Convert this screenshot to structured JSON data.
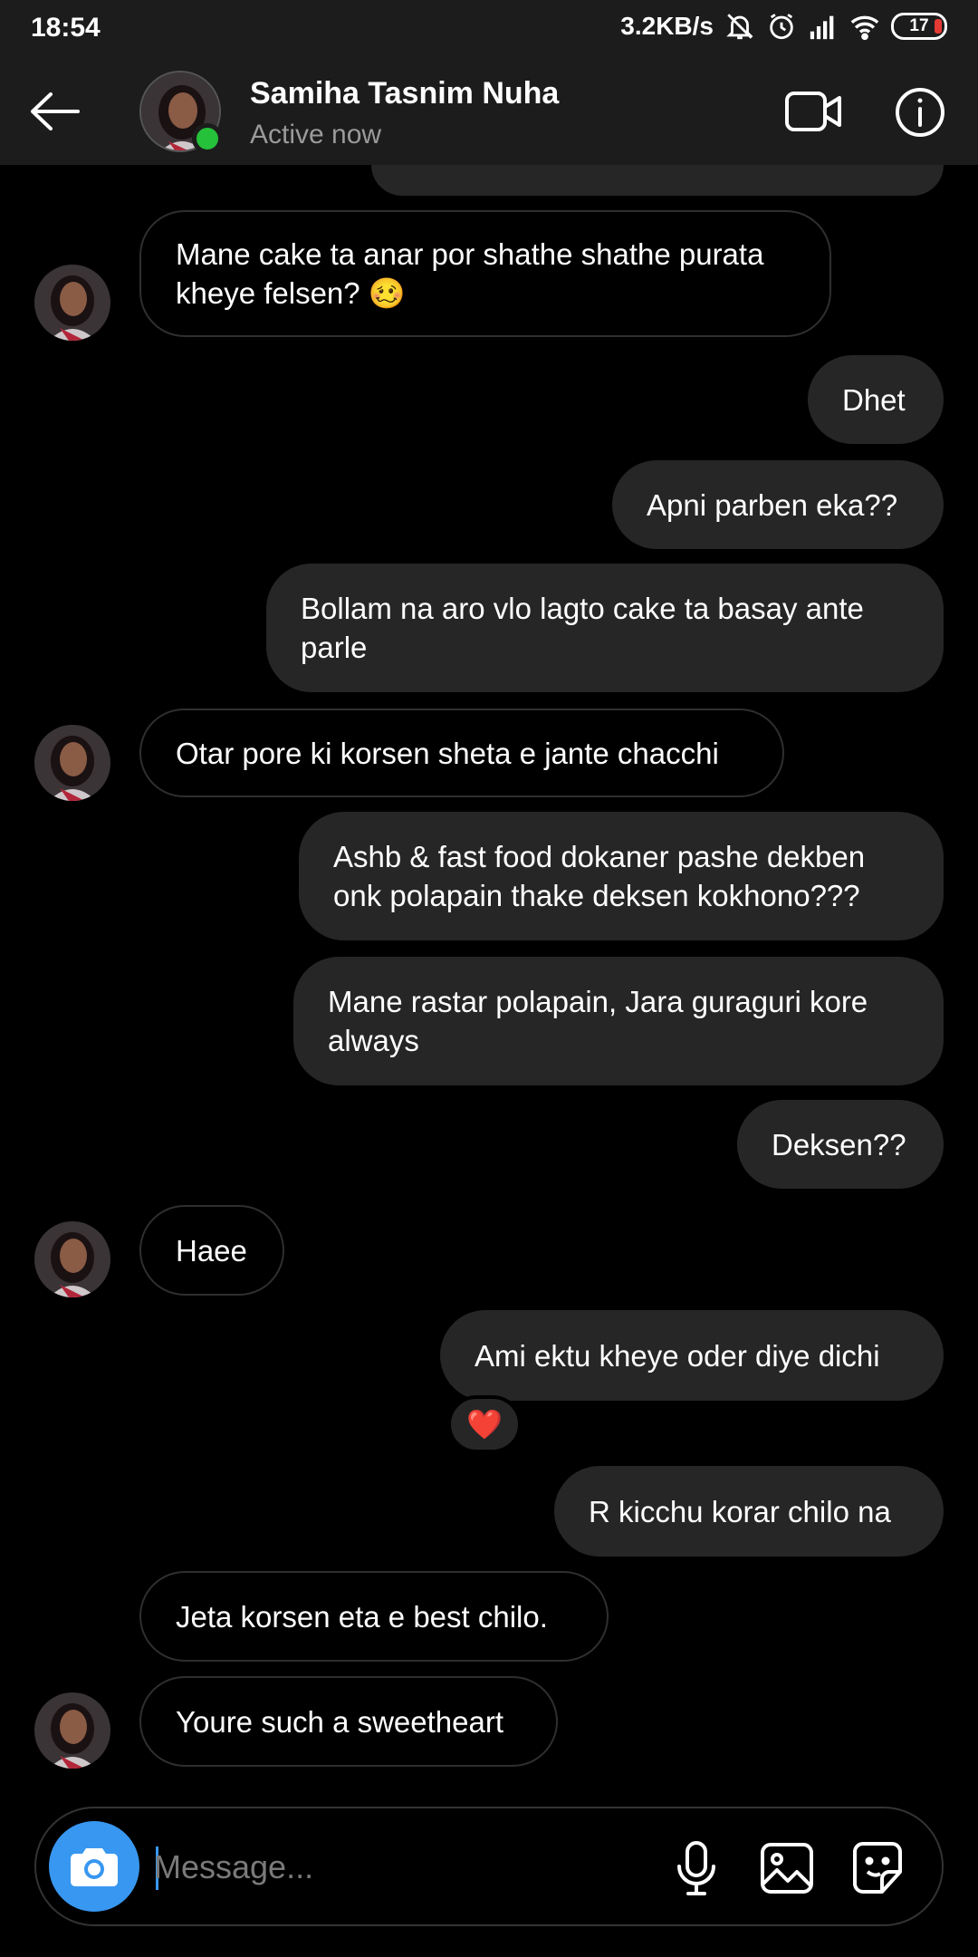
{
  "status_bar": {
    "time": "18:54",
    "network_speed": "3.2KB/s",
    "battery": "17",
    "icons": [
      "mute-bell-icon",
      "alarm-icon",
      "signal-icon",
      "wifi-icon",
      "battery-icon"
    ]
  },
  "header": {
    "name": "Samiha Tasnim Nuha",
    "status": "Active now",
    "online_color": "#26c13a"
  },
  "messages": [
    {
      "side": "in",
      "text": "Mane cake ta anar por shathe shathe purata kheye felsen? 🥴"
    },
    {
      "side": "out",
      "text": "Dhet"
    },
    {
      "side": "out",
      "text": "Apni parben eka??"
    },
    {
      "side": "out",
      "text": "Bollam na aro vlo lagto cake ta basay ante parle"
    },
    {
      "side": "in",
      "text": "Otar pore ki korsen sheta e jante chacchi"
    },
    {
      "side": "out",
      "text": "Ashb & fast food dokaner pashe dekben onk polapain thake deksen kokhono???"
    },
    {
      "side": "out",
      "text": "Mane rastar polapain, Jara guraguri kore always"
    },
    {
      "side": "out",
      "text": "Deksen??"
    },
    {
      "side": "in",
      "text": "Haee"
    },
    {
      "side": "out",
      "text": "Ami ektu kheye oder diye dichi"
    },
    {
      "side": "out",
      "text": "R kicchu korar chilo na"
    },
    {
      "side": "in",
      "text": "Jeta korsen eta e best chilo."
    },
    {
      "side": "in",
      "text": "Youre such a sweetheart"
    }
  ],
  "reaction": "❤️",
  "composer": {
    "placeholder": "Message..."
  },
  "colors": {
    "accent": "#3897f0",
    "bubble_out": "#262626",
    "background": "#000000"
  }
}
